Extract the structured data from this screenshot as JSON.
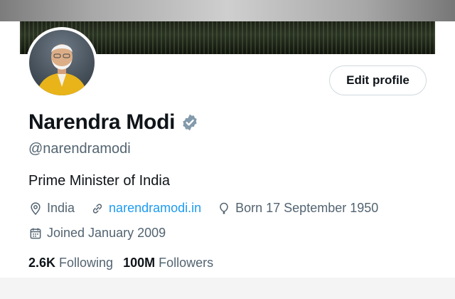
{
  "profile": {
    "name": "Narendra Modi",
    "handle": "@narendramodi",
    "bio": "Prime Minister of India",
    "location": "India",
    "website": "narendramodi.in",
    "born": "Born 17 September 1950",
    "joined": "Joined January 2009"
  },
  "stats": {
    "following_count": "2.6K",
    "following_label": "Following",
    "followers_count": "100M",
    "followers_label": "Followers"
  },
  "actions": {
    "edit_profile_label": "Edit profile"
  },
  "icons": [
    "verified-badge-icon",
    "location-pin-icon",
    "link-icon",
    "birthday-balloon-icon",
    "calendar-icon"
  ],
  "colors": {
    "link": "#1d9bf0",
    "secondary_text": "#536471",
    "primary_text": "#0f1419",
    "verified": "#829aab"
  }
}
